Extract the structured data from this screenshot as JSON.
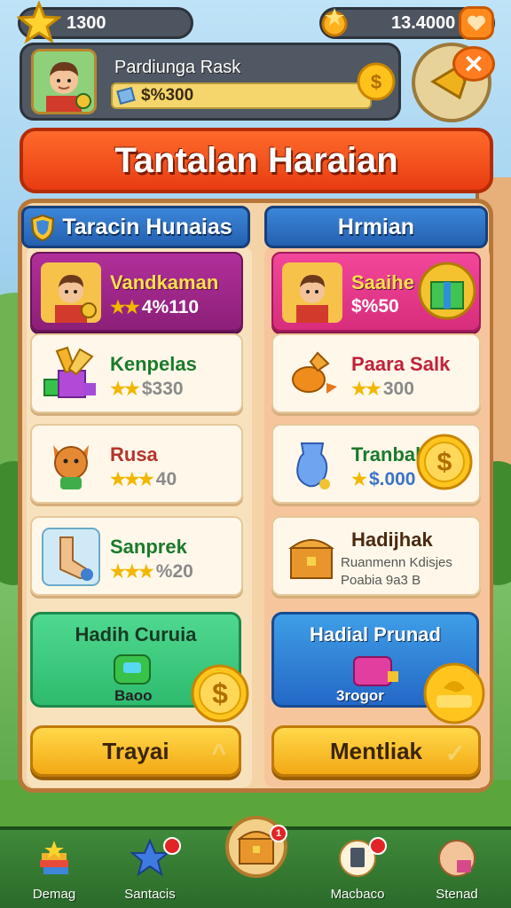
{
  "currency": {
    "stars": "1300",
    "gems": "13.4000"
  },
  "profile": {
    "name": "Pardiunga Rask",
    "bar_value": "$%300"
  },
  "title": "Tantalan Haraian",
  "columns": {
    "left_header": "Taracin Hunaias",
    "right_header": "Hrmian"
  },
  "left_cards": [
    {
      "name": "Vandkaman",
      "reward": "4%110",
      "stars": "★★"
    },
    {
      "name": "Kenpelas",
      "reward": "$330",
      "stars": "★★"
    },
    {
      "name": "Rusa",
      "reward": "40",
      "stars": "★★★"
    },
    {
      "name": "Sanprek",
      "reward": "%20",
      "stars": "★★★"
    }
  ],
  "right_cards": [
    {
      "name": "Saaihe",
      "reward": "$%50",
      "stars": ""
    },
    {
      "name": "Paara Salk",
      "reward": "300",
      "stars": "★★"
    },
    {
      "name": "Tranbak",
      "reward": "$.000",
      "stars": "★"
    },
    {
      "name": "Hadijhak",
      "line1": "Ruanmenn Kdisjes",
      "line2": "Poabia 9a3 B"
    }
  ],
  "rewards": {
    "left_title": "Hadih Curuia",
    "left_label": "Baoo",
    "right_title": "Hadial Prunad",
    "right_label": "3rogor"
  },
  "buttons": {
    "left": "Trayai",
    "right": "Mentliak"
  },
  "nav": [
    {
      "label": "Demag"
    },
    {
      "label": "Santacis"
    },
    {
      "label": "Macbaco"
    },
    {
      "label": "Stenad"
    }
  ],
  "badges": {
    "center": "1"
  },
  "colors": {
    "title_banner": "#e83c12",
    "header_blue": "#2460b0",
    "button_gold": "#f3a914",
    "nav_green": "#2b6a2a"
  }
}
